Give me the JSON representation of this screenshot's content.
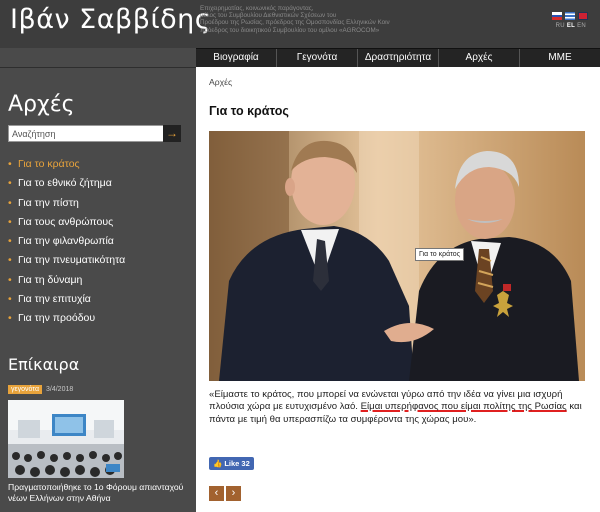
{
  "header": {
    "site_title": "Ιβάν Σαββίδης",
    "tagline": [
      "Επιχειρηματίας, κοινωνικός παράγοντας,",
      "μέλος του Συμβουλίου Διεθνιστικών Σχέσεων του",
      "Προέδρου της Ρωσίας, πρόεδρος της Ομοσπονδίας Ελληνικών Κοινοτήτων Ρωσίας,",
      "πρόεδρος του διοικητικού Συμβουλίου του ομίλου «AGROCOM»"
    ],
    "languages": [
      "RU",
      "EL",
      "EN"
    ],
    "active_language": "EL"
  },
  "topnav": [
    "Βιογραφία",
    "Γεγονότα",
    "Δραστηριότητα",
    "Αρχές",
    "ΜΜΕ"
  ],
  "sidebar": {
    "title": "Αρχές",
    "search": {
      "placeholder": "Αναζήτηση",
      "value": "",
      "button": "→"
    },
    "menu": [
      {
        "label": "Για το κράτος",
        "active": true
      },
      {
        "label": "Για το εθνικό ζήτημα",
        "active": false
      },
      {
        "label": "Για την πίστη",
        "active": false
      },
      {
        "label": "Για τους ανθρώπους",
        "active": false
      },
      {
        "label": "Για την φιλανθρωπία",
        "active": false
      },
      {
        "label": "Για την πνευματικότητα",
        "active": false
      },
      {
        "label": "Για τη δύναμη",
        "active": false
      },
      {
        "label": "Για την επιτυχία",
        "active": false
      },
      {
        "label": "Για την προόδου",
        "active": false
      }
    ],
    "news": {
      "title": "Επίκαιρα",
      "tag": "γεγονότα",
      "date": "3/4/2018",
      "caption": "Πραγματοποιήθηκε το 1ο Φόρουμ απιανταχού νέων Ελλήνων στην Αθήνα"
    }
  },
  "main": {
    "breadcrumb": "Αρχές",
    "title": "Για το κράτος",
    "photo_tooltip": "Για το κράτος",
    "quote_before": "«Είμαστε το κράτος, που μπορεί να ενώνεται γύρω από την ιδέα να γίνει μια ισχυρή πλούσια χώρα με ευτυχισμένο λαό. ",
    "quote_underlined": "Είμαι υπερήφανος που είμαι πολίτης της Ρωσίας",
    "quote_after": " και πάντα με τιμή θα υπερασπίζω τα συμφέροντα της χώρας μου».",
    "like_label": "Like 32",
    "prev": "‹",
    "next": "›"
  },
  "colors": {
    "accent": "#e8a33b",
    "header_bg": "#3d3d3d",
    "sidebar_bg": "#4a4a4a",
    "nav_bg": "#242424",
    "pager": "#a2622f",
    "underline": "#e02020"
  }
}
